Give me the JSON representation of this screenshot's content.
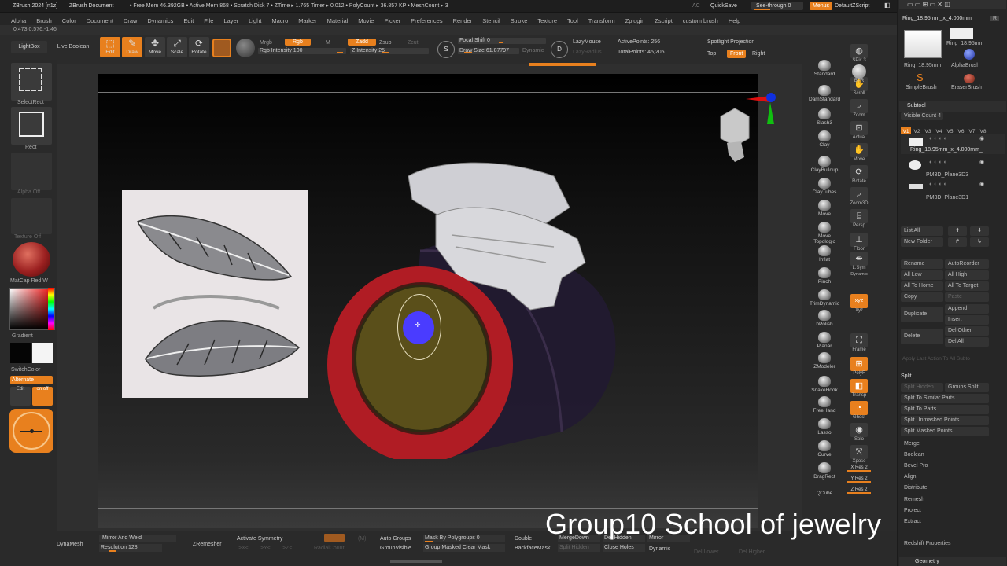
{
  "topbar": {
    "title": "ZBrush 2024 [n1z]",
    "document": "ZBrush Document",
    "stats": "• Free Mem 46.392GB • Active Mem 868 • Scratch Disk 7 • ZTime ▸ 1.765 Timer ▸ 0.012 • PolyCount ▸ 36.857 KP • MeshCount ▸ 3",
    "ac": "AC",
    "quicksave": "QuickSave",
    "seethrough": "See-through  0",
    "menus": "Menus",
    "defaultzscript": "DefaultZScript"
  },
  "menus": [
    "Alpha",
    "Brush",
    "Color",
    "Document",
    "Draw",
    "Dynamics",
    "Edit",
    "File",
    "Layer",
    "Light",
    "Macro",
    "Marker",
    "Material",
    "Movie",
    "Picker",
    "Preferences",
    "Render",
    "Stencil",
    "Stroke",
    "Texture",
    "Tool",
    "Transform",
    "Zplugin",
    "Zscript",
    "custom brush",
    "Help"
  ],
  "coords": "0.473,0.576,-1.46",
  "shelf": {
    "lightbox": "LightBox",
    "liveboolean": "Live Boolean",
    "edit": "Edit",
    "draw": "Draw",
    "move": "Move",
    "scale": "Scale",
    "rotate": "Rotate",
    "mrgb": "Mrgb",
    "rgb": "Rgb",
    "m": "M",
    "zadd": "Zadd",
    "zsub": "Zsub",
    "zcut": "Zcut",
    "rgb_intensity": "Rgb Intensity 100",
    "z_intensity": "Z Intensity 25",
    "focal_shift": "Focal Shift 0",
    "draw_size": "Draw Size 61.87797",
    "dynamic": "Dynamic",
    "lazymouse": "LazyMouse",
    "lazyradius": "LazyRadius",
    "active_points": "ActivePoints: 256",
    "total_points": "TotalPoints: 45,205",
    "spotlight": "Spotlight Projection",
    "top": "Top",
    "front": "Front",
    "right": "Right"
  },
  "left": {
    "selectrect": "SelectRect",
    "rect": "Rect",
    "alpha_off": "Alpha Off",
    "texture_off": "Texture Off",
    "matcap": "MatCap Red W",
    "gradient": "Gradient",
    "switchcolor": "SwitchColor",
    "alternate": "Alternate",
    "edit": "Edit",
    "onoff": "on off"
  },
  "brushes": [
    "Standard",
    "DamStandard",
    "Slash3",
    "Clay",
    "ClayBuildup",
    "ClayTubes",
    "Move",
    "Move Topologic",
    "Inflat",
    "Pinch",
    "TrimDynamic",
    "hPolish",
    "Planar",
    "ZModeler",
    "SnakeHook",
    "FreeHand",
    "Lasso",
    "Curve",
    "DragRect",
    "QCube"
  ],
  "nav": [
    "SPix 3",
    "Scroll",
    "Zoom",
    "Actual",
    "Move",
    "Rotate",
    "Zoom3D",
    "Persp",
    "Floor",
    "L.Sym",
    "Xyz",
    "Frame",
    "PolyF",
    "Transp",
    "Ghost",
    "Solo",
    "Xpose",
    "X Res 2",
    "Y Res 2",
    "Z Res 2"
  ],
  "nav_brm": "BPR",
  "nav_dynamic": "Dynamic",
  "panel": {
    "tool_name": "Ring_18.95mm_x_4.000mm",
    "thumb1": "Ring_18.95mm",
    "thumb2": "Ring_18.95mm",
    "alphabrush": "AlphaBrush",
    "simplebrush": "SimpleBrush",
    "eraserbrush": "EraserBrush",
    "r": "R",
    "subtool": "Subtool",
    "visible_count": "Visible Count 4",
    "versions": [
      "V1",
      "V2",
      "V3",
      "V4",
      "V5",
      "V6",
      "V7",
      "V8"
    ],
    "sub1": "Ring_18.95mm_x_4.000mm_",
    "sub2": "PM3D_Plane3D3",
    "sub3": "PM3D_Plane3D1",
    "listall": "List All",
    "newfolder": "New Folder",
    "rename": "Rename",
    "autoreorder": "AutoReorder",
    "alllow": "All Low",
    "allhigh": "All High",
    "alltohome": "All To Home",
    "alltotarget": "All To Target",
    "copy": "Copy",
    "paste": "Paste",
    "duplicate": "Duplicate",
    "append": "Append",
    "insert": "Insert",
    "delete": "Delete",
    "delother": "Del Other",
    "delall": "Del All",
    "applylast": "Apply Last Action To All Subto",
    "split": "Split",
    "splithidden": "Split Hidden",
    "groupssplit": "Groups Split",
    "splitsimilar": "Split To Similar Parts",
    "splitparts": "Split To Parts",
    "splitunmasked": "Split Unmasked Points",
    "splitmasked": "Split Masked Points",
    "merge": "Merge",
    "boolean": "Boolean",
    "bevelpro": "Bevel Pro",
    "align": "Align",
    "distribute": "Distribute",
    "remesh": "Remesh",
    "project": "Project",
    "extract": "Extract",
    "redshift": "Redshift Properties",
    "geometry": "Geometry"
  },
  "bottom": {
    "dynamesh": "DynaMesh",
    "mirrorweld": "Mirror And Weld",
    "resolution": "Resolution 128",
    "zremesher": "ZRemesher",
    "activatesym": "Activate Symmetry",
    "x": ">X<",
    "y": ">Y<",
    "z": ">Z<",
    "m": "(M)",
    "radialcount": "RadialCount",
    "autogroups": "Auto Groups",
    "groupvisible": "GroupVisible",
    "maskbypolygroups": "Mask By Polygroups 0",
    "groupmaskedclearmask": "Group Masked Clear Mask",
    "double": "Double",
    "backfacemask": "BackfaceMask",
    "mergedown": "MergeDown",
    "splithidden": "Split Hidden",
    "delhidden": "Del Hidden",
    "closeholes": "Close Holes",
    "mirror": "Mirror",
    "dynamic": "Dynamic",
    "dellower": "Del Lower",
    "delhigher": "Del Higher"
  },
  "watermark": "Group10 School of jewelry",
  "colors": {
    "accent": "#e8801e",
    "ring_red": "#b01c24",
    "inner_olive": "#5a4f1a",
    "brush_cursor": "#4a3cff"
  }
}
